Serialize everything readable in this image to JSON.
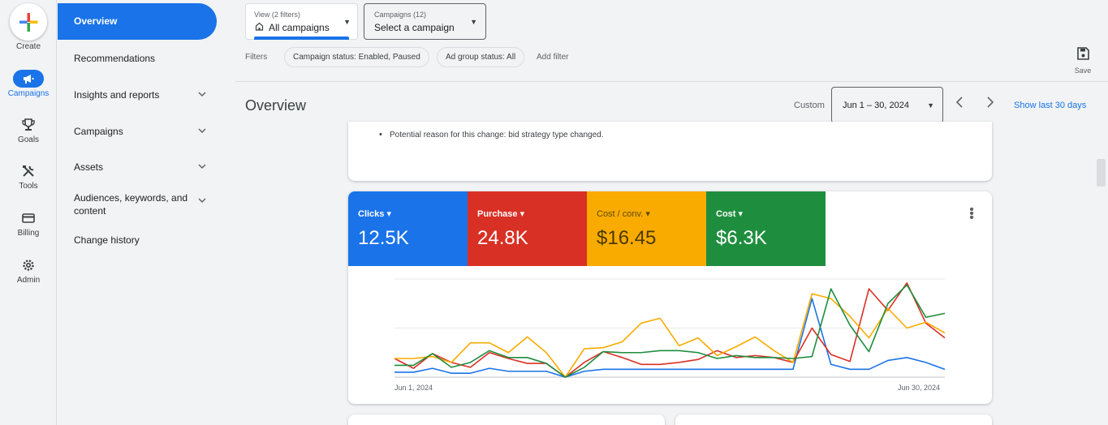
{
  "rail": {
    "create_label": "Create",
    "items": [
      {
        "label": "Campaigns",
        "icon": "megaphone-icon",
        "active": true
      },
      {
        "label": "Goals",
        "icon": "trophy-icon"
      },
      {
        "label": "Tools",
        "icon": "tools-icon"
      },
      {
        "label": "Billing",
        "icon": "credit-card-icon"
      },
      {
        "label": "Admin",
        "icon": "gear-icon"
      }
    ]
  },
  "nav": {
    "items": [
      {
        "label": "Overview",
        "active": true
      },
      {
        "label": "Recommendations"
      },
      {
        "label": "Insights and reports",
        "expandable": true
      },
      {
        "label": "Campaigns",
        "expandable": true
      },
      {
        "label": "Assets",
        "expandable": true
      },
      {
        "label": "Audiences, keywords, and content",
        "expandable": true
      },
      {
        "label": "Change history"
      }
    ]
  },
  "filterbar": {
    "view_small": "View (2 filters)",
    "view_value": "All campaigns",
    "campaigns_small": "Campaigns (12)",
    "campaigns_value": "Select a campaign",
    "filters_label": "Filters",
    "chips": [
      "Campaign status: Enabled, Paused",
      "Ad group status: All"
    ],
    "add_filter": "Add filter",
    "save_label": "Save"
  },
  "header": {
    "title": "Overview",
    "custom_label": "Custom",
    "date_range": "Jun 1 – 30, 2024",
    "show_last": "Show last 30 days"
  },
  "note_card": {
    "text": "Potential reason for this change: bid strategy type changed."
  },
  "metrics": [
    {
      "name": "Clicks",
      "value": "12.5K",
      "color": "#1a73e8"
    },
    {
      "name": "Purchase",
      "value": "24.8K",
      "color": "#d93025"
    },
    {
      "name": "Cost / conv.",
      "value": "$16.45",
      "color": "#f9ab00"
    },
    {
      "name": "Cost",
      "value": "$6.3K",
      "color": "#1e8e3e"
    }
  ],
  "chart": {
    "x_start": "Jun 1, 2024",
    "x_end": "Jun 30, 2024"
  },
  "chart_data": {
    "type": "line",
    "x": [
      1,
      2,
      3,
      4,
      5,
      6,
      7,
      8,
      9,
      10,
      11,
      12,
      13,
      14,
      15,
      16,
      17,
      18,
      19,
      20,
      21,
      22,
      23,
      24,
      25,
      26,
      27,
      28,
      29,
      30
    ],
    "ylim": [
      0,
      100
    ],
    "grid": true,
    "series": [
      {
        "name": "Clicks",
        "color": "#1a73e8",
        "values": [
          5,
          5,
          9,
          4,
          4,
          9,
          6,
          6,
          6,
          0,
          6,
          8,
          8,
          8,
          8,
          8,
          8,
          8,
          8,
          8,
          8,
          8,
          80,
          13,
          8,
          8,
          17,
          20,
          15,
          8
        ]
      },
      {
        "name": "Purchase",
        "color": "#d93025",
        "values": [
          19,
          9,
          24,
          15,
          10,
          25,
          19,
          14,
          14,
          0,
          15,
          26,
          20,
          13,
          13,
          15,
          18,
          27,
          20,
          22,
          20,
          15,
          50,
          23,
          16,
          90,
          68,
          96,
          55,
          40
        ]
      },
      {
        "name": "Cost / conv.",
        "color": "#f9ab00",
        "values": [
          19,
          19,
          21,
          15,
          35,
          35,
          25,
          41,
          25,
          0,
          29,
          30,
          36,
          55,
          60,
          32,
          40,
          22,
          31,
          41,
          27,
          15,
          85,
          80,
          62,
          40,
          70,
          50,
          56,
          45
        ]
      },
      {
        "name": "Cost",
        "color": "#1e8e3e",
        "values": [
          12,
          12,
          24,
          10,
          15,
          27,
          20,
          20,
          14,
          0,
          10,
          26,
          25,
          25,
          27,
          27,
          25,
          19,
          22,
          20,
          20,
          19,
          21,
          90,
          53,
          26,
          75,
          94,
          61,
          65
        ]
      }
    ]
  }
}
